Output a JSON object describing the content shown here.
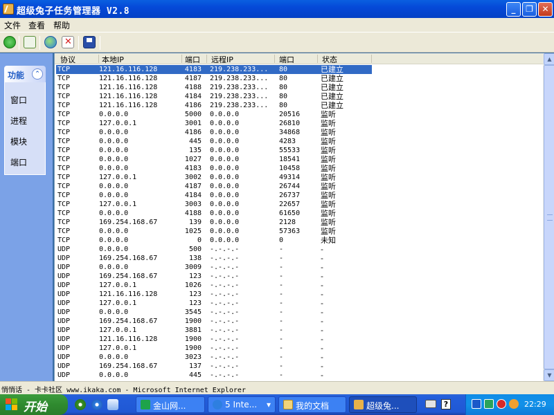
{
  "window": {
    "title": "超级兔子任务管理器 V2.8",
    "controls": {
      "minimize": "_",
      "maximize": "❐",
      "close": "✕"
    }
  },
  "menu": [
    "文件",
    "查看",
    "帮助"
  ],
  "toolbar": {
    "icons": [
      "back-icon",
      "refresh-icon",
      "globe-icon",
      "end-connection-icon",
      "save-icon"
    ]
  },
  "sidebar": {
    "header": "功能",
    "collapse_glyph": "⌃",
    "items": [
      "窗口",
      "进程",
      "模块",
      "端口"
    ]
  },
  "table": {
    "columns": [
      "协议",
      "本地IP",
      "端口",
      "远程IP",
      "端口",
      "状态"
    ],
    "rows": [
      [
        "TCP",
        "121.16.116.128",
        "4183",
        "219.238.233...",
        "80",
        "已建立"
      ],
      [
        "TCP",
        "121.16.116.128",
        "4187",
        "219.238.233...",
        "80",
        "已建立"
      ],
      [
        "TCP",
        "121.16.116.128",
        "4188",
        "219.238.233...",
        "80",
        "已建立"
      ],
      [
        "TCP",
        "121.16.116.128",
        "4184",
        "219.238.233...",
        "80",
        "已建立"
      ],
      [
        "TCP",
        "121.16.116.128",
        "4186",
        "219.238.233...",
        "80",
        "已建立"
      ],
      [
        "TCP",
        "0.0.0.0",
        "5000",
        "0.0.0.0",
        "20516",
        "监听"
      ],
      [
        "TCP",
        "127.0.0.1",
        "3001",
        "0.0.0.0",
        "26810",
        "监听"
      ],
      [
        "TCP",
        "0.0.0.0",
        "4186",
        "0.0.0.0",
        "34868",
        "监听"
      ],
      [
        "TCP",
        "0.0.0.0",
        "445",
        "0.0.0.0",
        "4283",
        "监听"
      ],
      [
        "TCP",
        "0.0.0.0",
        "135",
        "0.0.0.0",
        "55533",
        "监听"
      ],
      [
        "TCP",
        "0.0.0.0",
        "1027",
        "0.0.0.0",
        "18541",
        "监听"
      ],
      [
        "TCP",
        "0.0.0.0",
        "4183",
        "0.0.0.0",
        "10458",
        "监听"
      ],
      [
        "TCP",
        "127.0.0.1",
        "3002",
        "0.0.0.0",
        "49314",
        "监听"
      ],
      [
        "TCP",
        "0.0.0.0",
        "4187",
        "0.0.0.0",
        "26744",
        "监听"
      ],
      [
        "TCP",
        "0.0.0.0",
        "4184",
        "0.0.0.0",
        "26737",
        "监听"
      ],
      [
        "TCP",
        "127.0.0.1",
        "3003",
        "0.0.0.0",
        "22657",
        "监听"
      ],
      [
        "TCP",
        "0.0.0.0",
        "4188",
        "0.0.0.0",
        "61650",
        "监听"
      ],
      [
        "TCP",
        "169.254.168.67",
        "139",
        "0.0.0.0",
        "2128",
        "监听"
      ],
      [
        "TCP",
        "0.0.0.0",
        "1025",
        "0.0.0.0",
        "57363",
        "监听"
      ],
      [
        "TCP",
        "0.0.0.0",
        "0",
        "0.0.0.0",
        "0",
        "未知"
      ],
      [
        "UDP",
        "0.0.0.0",
        "500",
        "-.-.-.-",
        "-",
        "-"
      ],
      [
        "UDP",
        "169.254.168.67",
        "138",
        "-.-.-.-",
        "-",
        "-"
      ],
      [
        "UDP",
        "0.0.0.0",
        "3009",
        "-.-.-.-",
        "-",
        "-"
      ],
      [
        "UDP",
        "169.254.168.67",
        "123",
        "-.-.-.-",
        "-",
        "-"
      ],
      [
        "UDP",
        "127.0.0.1",
        "1026",
        "-.-.-.-",
        "-",
        "-"
      ],
      [
        "UDP",
        "121.16.116.128",
        "123",
        "-.-.-.-",
        "-",
        "-"
      ],
      [
        "UDP",
        "127.0.0.1",
        "123",
        "-.-.-.-",
        "-",
        "-"
      ],
      [
        "UDP",
        "0.0.0.0",
        "3545",
        "-.-.-.-",
        "-",
        "-"
      ],
      [
        "UDP",
        "169.254.168.67",
        "1900",
        "-.-.-.-",
        "-",
        "-"
      ],
      [
        "UDP",
        "127.0.0.1",
        "3881",
        "-.-.-.-",
        "-",
        "-"
      ],
      [
        "UDP",
        "121.16.116.128",
        "1900",
        "-.-.-.-",
        "-",
        "-"
      ],
      [
        "UDP",
        "127.0.0.1",
        "1900",
        "-.-.-.-",
        "-",
        "-"
      ],
      [
        "UDP",
        "0.0.0.0",
        "3023",
        "-.-.-.-",
        "-",
        "-"
      ],
      [
        "UDP",
        "169.254.168.67",
        "137",
        "-.-.-.-",
        "-",
        "-"
      ],
      [
        "UDP",
        "0.0.0.0",
        "445",
        "-.-.-.-",
        "-",
        "-"
      ]
    ],
    "selected_row": 0
  },
  "scrollbar": {
    "up": "▲",
    "down": "▼"
  },
  "statusbar": {
    "text": "悄悄话 - 卡卡社区 www.ikaka.com - Microsoft Internet Explorer"
  },
  "taskbar": {
    "start": "开始",
    "tasks": [
      {
        "label": "金山网...",
        "active": false
      },
      {
        "label": "5 Inte...",
        "active": false,
        "dropdown": "▾"
      },
      {
        "label": "我的文档",
        "active": false
      },
      {
        "label": "超级兔...",
        "active": true
      }
    ],
    "keyboard_icon": "keyboard-icon",
    "help_glyph": "?",
    "clock": "22:29"
  },
  "colors": {
    "titlebar": "#0549d8",
    "selection": "#316ac5",
    "sidebar": "#7ba2e7",
    "taskbar": "#245edb",
    "start": "#2f8a2f"
  }
}
